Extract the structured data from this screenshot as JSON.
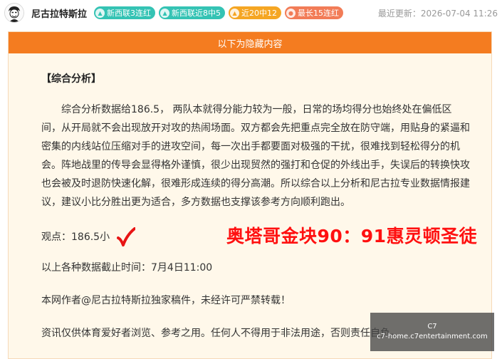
{
  "header": {
    "author_name": "尼古拉特斯拉",
    "badges": [
      {
        "label": "新西联3连红",
        "icon": "chevron-up-icon",
        "color": "#34c3b4"
      },
      {
        "label": "新西联近8中5",
        "icon": "chevron-up-icon",
        "color": "#34c3b4"
      },
      {
        "label": "近20中12",
        "icon": "chevron-up-icon",
        "color": "#f5a623"
      },
      {
        "label": "最长15连红",
        "icon": "flame-icon",
        "color": "#f27c57"
      }
    ],
    "last_updated": "最近更新：2026-07-04 11:26"
  },
  "content": {
    "banner": "以下为隐藏内容",
    "section_title": "【综合分析】",
    "analysis": "综合分析数据给186.5， 两队本就得分能力较为一般，日常的场均得分也始终处在偏低区间，从开局就不会出现放开对攻的热闹场面。双方都会先把重点完全放在防守端，用贴身的紧逼和密集的内线站位压缩对手的进攻空间，每一次出手都要面对极强的干扰，很难找到轻松得分的机会。阵地战里的传导会显得格外谨慎，很少出现贸然的强打和仓促的外线出手，失误后的转换快攻也会被及时退防快速化解，很难形成连续的得分高潮。所以综合以上分析和尼古拉专业数据情报建议，建议小比分胜出更为适合，多方数据也支撑该参考方向顺利跑出。",
    "viewpoint": "观点：186.5小",
    "data_cutoff": "以上各种数据截止时间：7月4日11:00",
    "copyright": "本网作者@尼古拉特斯拉独家稿件，未经许可严禁转载！",
    "disclaimer": "资讯仅供体育爱好者浏览、参考之用。任何人不得用于非法用途，否则责任自负。"
  },
  "overlay_text": "奥塔哥金块90：91惠灵顿圣徒",
  "watermark": {
    "line1": "C7",
    "line2": "c7-home.c7entertainment.com"
  },
  "colors": {
    "banner": "#f47c20",
    "card_background": "#fff8ea",
    "overlay_text": "#ff1010",
    "check_mark": "#e81414"
  }
}
